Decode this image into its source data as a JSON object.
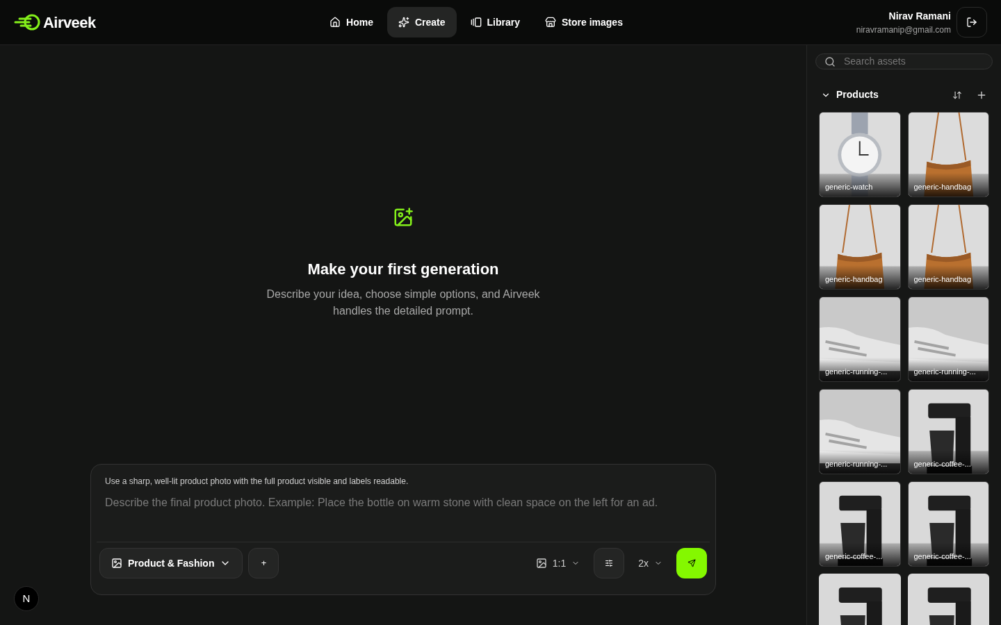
{
  "brand": {
    "name": "Airveek"
  },
  "nav": [
    {
      "label": "Home",
      "selected": false
    },
    {
      "label": "Create",
      "selected": true
    },
    {
      "label": "Library",
      "selected": false
    },
    {
      "label": "Store images",
      "selected": false
    }
  ],
  "user": {
    "name": "Nirav Ramani",
    "email": "niravramanip@gmail.com"
  },
  "empty_state": {
    "title": "Make your first generation",
    "text": "Describe your idea, choose simple options, and Airveek handles the detailed prompt."
  },
  "composer": {
    "hint": "Use a sharp, well-lit product photo with the full product visible and labels readable.",
    "placeholder": "Describe the final product photo. Example: Place the bottle on warm stone with clean space on the left for an ad.",
    "category": "Product & Fashion",
    "add": "+",
    "aspect": "1:1",
    "scale": "2x"
  },
  "sidebar": {
    "search_placeholder": "Search assets",
    "section": {
      "title": "Products",
      "expanded": true
    },
    "assets": [
      {
        "kind": "watch",
        "label": "generic-watch"
      },
      {
        "kind": "handbag",
        "label": "generic-handbag"
      },
      {
        "kind": "handbag",
        "label": "generic-handbag"
      },
      {
        "kind": "handbag",
        "label": "generic-handbag"
      },
      {
        "kind": "shoe",
        "label": "generic-running-..."
      },
      {
        "kind": "shoe",
        "label": "generic-running-..."
      },
      {
        "kind": "shoe",
        "label": "generic-running-..."
      },
      {
        "kind": "coffee",
        "label": "generic-coffee-..."
      },
      {
        "kind": "coffee",
        "label": "generic-coffee-..."
      },
      {
        "kind": "coffee",
        "label": "generic-coffee-..."
      },
      {
        "kind": "coffee"
      },
      {
        "kind": "coffee"
      }
    ]
  },
  "dev_badge": "N"
}
